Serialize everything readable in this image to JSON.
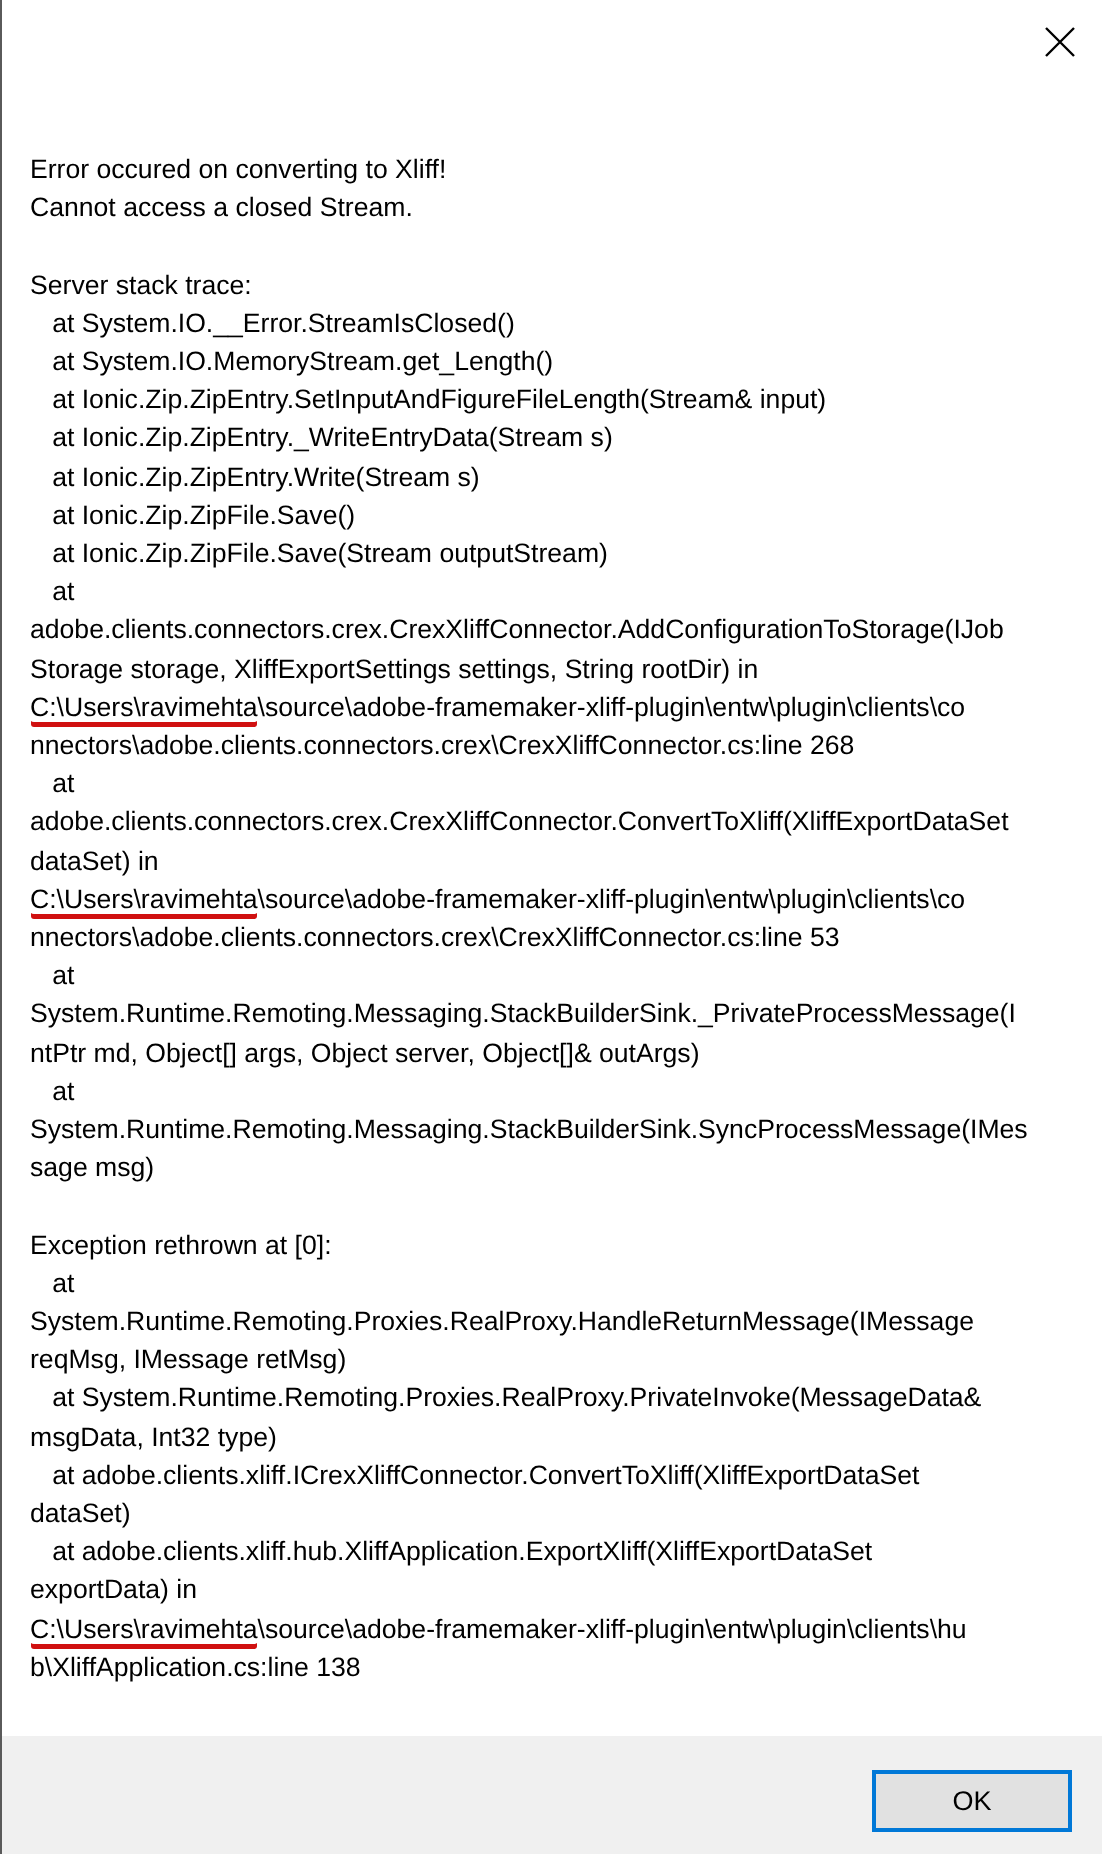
{
  "dialog": {
    "paragraphs": [
      [
        {
          "kind": "plain",
          "text": "Error occured on converting to Xliff!"
        },
        {
          "kind": "plain",
          "text": "Cannot access a closed Stream."
        }
      ],
      [
        {
          "kind": "plain",
          "text": "Server stack trace:"
        },
        {
          "kind": "plain",
          "text": "   at System.IO.__Error.StreamIsClosed()"
        },
        {
          "kind": "plain",
          "text": "   at System.IO.MemoryStream.get_Length()"
        },
        {
          "kind": "plain",
          "text": "   at Ionic.Zip.ZipEntry.SetInputAndFigureFileLength(Stream& input)"
        },
        {
          "kind": "plain",
          "text": "   at Ionic.Zip.ZipEntry._WriteEntryData(Stream s)"
        },
        {
          "kind": "plain",
          "text": "   at Ionic.Zip.ZipEntry.Write(Stream s)"
        },
        {
          "kind": "plain",
          "text": "   at Ionic.Zip.ZipFile.Save()"
        },
        {
          "kind": "plain",
          "text": "   at Ionic.Zip.ZipFile.Save(Stream outputStream)"
        },
        {
          "kind": "plain",
          "text": "   at"
        },
        {
          "kind": "plain",
          "text": "adobe.clients.connectors.crex.CrexXliffConnector.AddConfigurationToStorage(IJob"
        },
        {
          "kind": "plain",
          "text": "Storage storage, XliffExportSettings settings, String rootDir) in"
        },
        {
          "kind": "path",
          "marked": "C:\\Users\\ravimehta",
          "text": "\\source\\adobe-framemaker-xliff-plugin\\entw\\plugin\\clients\\co"
        },
        {
          "kind": "plain",
          "text": "nnectors\\adobe.clients.connectors.crex\\CrexXliffConnector.cs:line 268"
        },
        {
          "kind": "plain",
          "text": "   at"
        },
        {
          "kind": "plain",
          "text": "adobe.clients.connectors.crex.CrexXliffConnector.ConvertToXliff(XliffExportDataSet"
        },
        {
          "kind": "plain",
          "text": "dataSet) in"
        },
        {
          "kind": "path",
          "marked": "C:\\Users\\ravimehta",
          "text": "\\source\\adobe-framemaker-xliff-plugin\\entw\\plugin\\clients\\co"
        },
        {
          "kind": "plain",
          "text": "nnectors\\adobe.clients.connectors.crex\\CrexXliffConnector.cs:line 53"
        },
        {
          "kind": "plain",
          "text": "   at"
        },
        {
          "kind": "plain",
          "text": "System.Runtime.Remoting.Messaging.StackBuilderSink._PrivateProcessMessage(I"
        },
        {
          "kind": "plain",
          "text": "ntPtr md, Object[] args, Object server, Object[]& outArgs)"
        },
        {
          "kind": "plain",
          "text": "   at"
        },
        {
          "kind": "plain",
          "text": "System.Runtime.Remoting.Messaging.StackBuilderSink.SyncProcessMessage(IMes"
        },
        {
          "kind": "plain",
          "text": "sage msg)"
        }
      ],
      [
        {
          "kind": "plain",
          "text": "Exception rethrown at [0]:"
        },
        {
          "kind": "plain",
          "text": "   at"
        },
        {
          "kind": "plain",
          "text": "System.Runtime.Remoting.Proxies.RealProxy.HandleReturnMessage(IMessage"
        },
        {
          "kind": "plain",
          "text": "reqMsg, IMessage retMsg)"
        },
        {
          "kind": "plain",
          "text": "   at System.Runtime.Remoting.Proxies.RealProxy.PrivateInvoke(MessageData&"
        },
        {
          "kind": "plain",
          "text": "msgData, Int32 type)"
        },
        {
          "kind": "plain",
          "text": "   at adobe.clients.xliff.ICrexXliffConnector.ConvertToXliff(XliffExportDataSet"
        },
        {
          "kind": "plain",
          "text": "dataSet)"
        },
        {
          "kind": "plain",
          "text": "   at adobe.clients.xliff.hub.XliffApplication.ExportXliff(XliffExportDataSet"
        },
        {
          "kind": "plain",
          "text": "exportData) in"
        },
        {
          "kind": "path",
          "marked": "C:\\Users\\ravimehta",
          "text": "\\source\\adobe-framemaker-xliff-plugin\\entw\\plugin\\clients\\hu"
        },
        {
          "kind": "plain",
          "text": "b\\XliffApplication.cs:line 138"
        }
      ]
    ],
    "buttons": [
      "OK"
    ]
  }
}
